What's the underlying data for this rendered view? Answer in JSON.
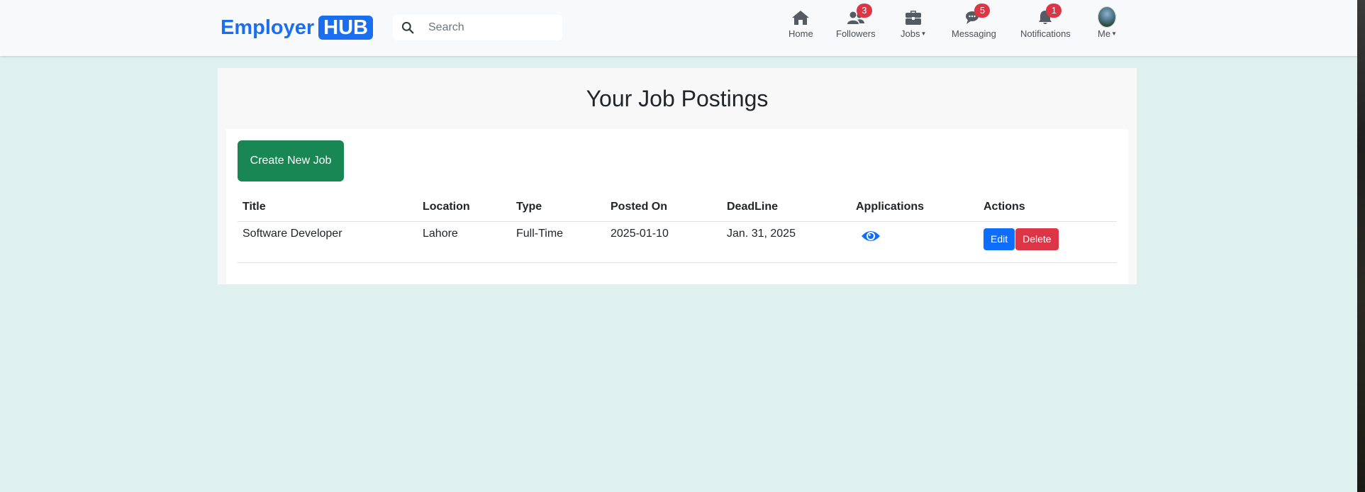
{
  "brand": {
    "text": "Employer",
    "badge": "HUB"
  },
  "search": {
    "placeholder": "Search"
  },
  "nav": {
    "home": {
      "label": "Home",
      "icon": "home-icon"
    },
    "followers": {
      "label": "Followers",
      "icon": "users-icon",
      "badge": "3"
    },
    "jobs": {
      "label": "Jobs",
      "icon": "briefcase-icon"
    },
    "messaging": {
      "label": "Messaging",
      "icon": "chat-icon",
      "badge": "5"
    },
    "notifications": {
      "label": "Notifications",
      "icon": "bell-icon",
      "badge": "1"
    },
    "me": {
      "label": "Me",
      "icon": "avatar"
    }
  },
  "page": {
    "title": "Your Job Postings",
    "create_button": "Create New Job"
  },
  "table": {
    "headers": [
      "Title",
      "Location",
      "Type",
      "Posted On",
      "DeadLine",
      "Applications",
      "Actions"
    ],
    "rows": [
      {
        "title": "Software Developer",
        "location": "Lahore",
        "type": "Full-Time",
        "posted_on": "2025-01-10",
        "deadline": "Jan. 31, 2025",
        "applications_icon": "eye-icon",
        "edit_label": "Edit",
        "delete_label": "Delete"
      }
    ]
  },
  "colors": {
    "brand": "#1a6ff0",
    "success": "#198754",
    "primary": "#0d6efd",
    "danger": "#dc3545",
    "background": "#dff1ee"
  }
}
